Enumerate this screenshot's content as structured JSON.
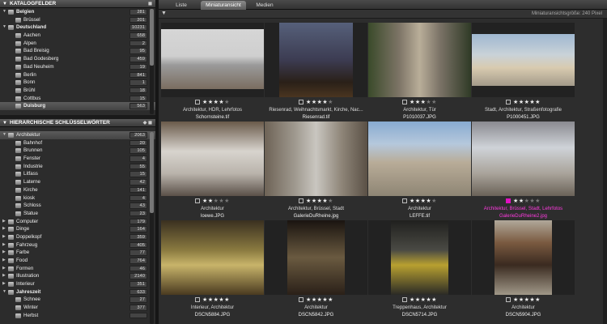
{
  "catalog": {
    "title": "KATALOGFELDER",
    "items": [
      {
        "label": "Belgien",
        "count": "281",
        "level": 0,
        "expanded": true,
        "bold": true
      },
      {
        "label": "Brüssel",
        "count": "201",
        "level": 1
      },
      {
        "label": "Deutschland",
        "count": "10231",
        "level": 0,
        "expanded": true,
        "bold": true
      },
      {
        "label": "Aachen",
        "count": "658",
        "level": 1
      },
      {
        "label": "Alpen",
        "count": "2",
        "level": 1
      },
      {
        "label": "Bad Breisig",
        "count": "95",
        "level": 1
      },
      {
        "label": "Bad Godesberg",
        "count": "459",
        "level": 1
      },
      {
        "label": "Bad Neuheim",
        "count": "19",
        "level": 1
      },
      {
        "label": "Berlin",
        "count": "841",
        "level": 1
      },
      {
        "label": "Bonn",
        "count": "1",
        "level": 1
      },
      {
        "label": "Brühl",
        "count": "18",
        "level": 1
      },
      {
        "label": "Cottbus",
        "count": "15",
        "level": 1
      },
      {
        "label": "Duisburg",
        "count": "563",
        "level": 1,
        "selected": true,
        "bold": true
      }
    ]
  },
  "keywords": {
    "title": "HIERARCHISCHE SCHLÜSSELWÖRTER",
    "items": [
      {
        "label": "Architektur",
        "count": "2063",
        "level": 0,
        "expanded": true,
        "selected": true
      },
      {
        "label": "Bahnhof",
        "count": "20",
        "level": 1
      },
      {
        "label": "Brunnen",
        "count": "105",
        "level": 1
      },
      {
        "label": "Fenster",
        "count": "4",
        "level": 1
      },
      {
        "label": "Industrie",
        "count": "55",
        "level": 1
      },
      {
        "label": "Litfass",
        "count": "15",
        "level": 1
      },
      {
        "label": "Laterne",
        "count": "42",
        "level": 1
      },
      {
        "label": "Kirche",
        "count": "141",
        "level": 1
      },
      {
        "label": "kiosk",
        "count": "4",
        "level": 1
      },
      {
        "label": "Schloss",
        "count": "43",
        "level": 1
      },
      {
        "label": "Statue",
        "count": "23",
        "level": 1
      },
      {
        "label": "Computer",
        "count": "179",
        "level": 0
      },
      {
        "label": "Dinge",
        "count": "164",
        "level": 0
      },
      {
        "label": "Doppelkopf",
        "count": "359",
        "level": 0
      },
      {
        "label": "Fahrzeug",
        "count": "405",
        "level": 0
      },
      {
        "label": "Farbe",
        "count": "77",
        "level": 0
      },
      {
        "label": "Food",
        "count": "764",
        "level": 0
      },
      {
        "label": "Formen",
        "count": "46",
        "level": 0
      },
      {
        "label": "Illustration",
        "count": "2140",
        "level": 0
      },
      {
        "label": "Interieur",
        "count": "351",
        "level": 0
      },
      {
        "label": "Jahreszeit",
        "count": "633",
        "level": 0,
        "expanded": true,
        "bold": true
      },
      {
        "label": "Schnee",
        "count": "27",
        "level": 1
      },
      {
        "label": "Winter",
        "count": "377",
        "level": 1
      },
      {
        "label": "Herbst",
        "count": "",
        "level": 1
      }
    ]
  },
  "tabs": [
    {
      "label": "Liste",
      "active": false
    },
    {
      "label": "Miniaturansicht",
      "active": true
    },
    {
      "label": "Medien",
      "active": false
    }
  ],
  "toolbar": {
    "thumb_size_label": "Miniaturansichtsgröße: 240 Pixel"
  },
  "thumbnails": [
    {
      "keywords": "Architektur, HDR, Lehrfotos",
      "filename": "Schornsteine.tif",
      "rating": 4,
      "selected": false
    },
    {
      "keywords": "Riesenrad, Weihnachtsmarkt, Kirche, Nac...",
      "filename": "Riesenrad.tif",
      "rating": 4,
      "selected": false
    },
    {
      "keywords": "Architektur, Tür",
      "filename": "P1010037.JPG",
      "rating": 3,
      "selected": false
    },
    {
      "keywords": "Stadt, Architektur, Straßenfotografie",
      "filename": "P1000451.JPG",
      "rating": 5,
      "selected": false
    },
    {
      "keywords": "Architektur",
      "filename": "loewe.JPG",
      "rating": 2,
      "selected": false
    },
    {
      "keywords": "Architektur, Brüssel, Stadt",
      "filename": "GalerieDuRheine.jpg",
      "rating": 4,
      "selected": false
    },
    {
      "keywords": "Architektur",
      "filename": "LEFFE.tif",
      "rating": 4,
      "selected": false
    },
    {
      "keywords": "Architektur, Brüssel, Stadt, Lehrfotos",
      "filename": "GalerieDuRheine2.jpg",
      "rating": 2,
      "selected": true
    },
    {
      "keywords": "Interieur, Architektur",
      "filename": "DSCN5884.JPG",
      "rating": 5,
      "selected": false
    },
    {
      "keywords": "Architektur",
      "filename": "DSCN5842.JPG",
      "rating": 5,
      "selected": false
    },
    {
      "keywords": "Treppenhaus, Architektur",
      "filename": "DSCN5714.JPG",
      "rating": 5,
      "selected": false
    },
    {
      "keywords": "Architektur",
      "filename": "DSCN5904.JPG",
      "rating": 5,
      "selected": false
    }
  ]
}
